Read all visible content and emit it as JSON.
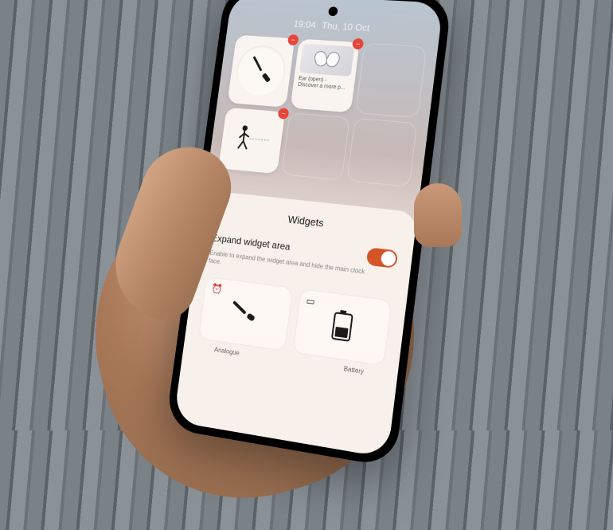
{
  "status": {
    "time": "19:04",
    "date": "Thu, 10 Oct"
  },
  "widgets": {
    "ear": {
      "title": "Ear (open) -",
      "subtitle": "Discover a more p..."
    }
  },
  "panel": {
    "title": "Widgets",
    "expand": {
      "label": "Expand widget area",
      "desc": "Enable to expand the widget area and hide the main clock face."
    },
    "previews": {
      "analogue": "Analogue",
      "battery": "Battery"
    }
  }
}
